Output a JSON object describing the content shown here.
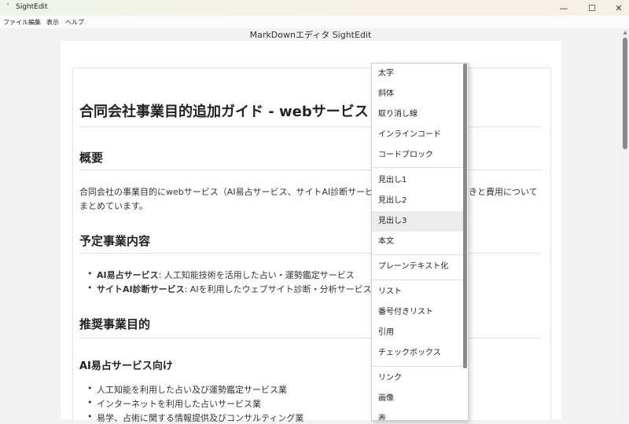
{
  "window": {
    "title": "SightEdit",
    "icon_glyph": "˅",
    "minimize_glyph": "—",
    "maximize_glyph": "☐",
    "close_glyph": "✕"
  },
  "menubar": [
    "ファイル",
    "編集",
    "表示",
    "ヘルプ"
  ],
  "doc_title": "MarkDownエディタ SightEdit",
  "content": {
    "h1": "合同会社事業目的追加ガイド - webサービス",
    "overview_heading": "概要",
    "overview_line1_left": "合同会社の事業目的にwebサービス（AI易占サービス、サイトAI診断サービス",
    "overview_line1_right": "きと費用について",
    "overview_line2": "まとめています。",
    "planned_heading": "予定事業内容",
    "planned_items": [
      {
        "bold": "AI易占サービス",
        "rest": ": 人工知能技術を活用した占い・運勢鑑定サービス"
      },
      {
        "bold": "サイトAI診断サービス",
        "rest": ": AIを利用したウェブサイト診断・分析サービス"
      }
    ],
    "recommended_heading": "推奨事業目的",
    "ai_heading": "AI易占サービス向け",
    "ai_items": [
      "人工知能を利用した占い及び運勢鑑定サービス業",
      "インターネットを利用した占いサービス業",
      "易学、占術に関する情報提供及びコンサルティング業"
    ]
  },
  "context_menu": {
    "items": [
      {
        "label": "太字"
      },
      {
        "label": "斜体"
      },
      {
        "label": "取り消し線"
      },
      {
        "label": "インラインコード"
      },
      {
        "label": "コードブロック"
      },
      {
        "label": "見出し1"
      },
      {
        "label": "見出し2"
      },
      {
        "label": "見出し3"
      },
      {
        "label": "本文"
      },
      {
        "label": "プレーンテキスト化"
      },
      {
        "label": "リスト"
      },
      {
        "label": "番号付きリスト"
      },
      {
        "label": "引用"
      },
      {
        "label": "チェックボックス"
      },
      {
        "label": "リンク"
      },
      {
        "label": "画像"
      },
      {
        "label": "表"
      }
    ],
    "hover_color": "#ececec"
  }
}
